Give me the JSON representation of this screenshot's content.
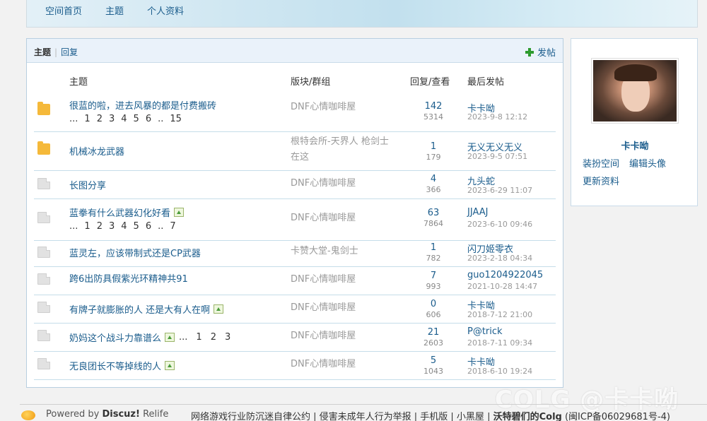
{
  "nav": [
    "空间首页",
    "主题",
    "个人资料"
  ],
  "box_head": {
    "tab_current": "主题",
    "tab_separator": "|",
    "tab_reply": "回复",
    "post_label": "发帖"
  },
  "columns": {
    "title": "主题",
    "forum": "版块/群组",
    "rv": "回复/查看",
    "last": "最后发帖"
  },
  "threads": [
    {
      "icon": "folder",
      "title": "很蓝的啦，进去风暴的都是付费搬砖",
      "pages": [
        "...",
        "1",
        "2",
        "3",
        "4",
        "5",
        "6",
        "..",
        "15"
      ],
      "forum": "DNF心情咖啡屋",
      "replies": "142",
      "views": "5314",
      "last_user": "卡卡呦",
      "last_time": "2023-9-8 12:12"
    },
    {
      "icon": "folder",
      "title": "机械冰龙武器",
      "forum": "根特会所-天界人 枪剑士在这",
      "replies": "1",
      "views": "179",
      "last_user": "无义无义无义",
      "last_time": "2023-9-5 07:51"
    },
    {
      "icon": "doc",
      "title": "长图分享",
      "forum": "DNF心情咖啡屋",
      "replies": "4",
      "views": "366",
      "last_user": "九头蛇",
      "last_time": "2023-6-29 11:07"
    },
    {
      "icon": "doc",
      "title": "蓝拳有什么武器幻化好看",
      "has_image": true,
      "pages": [
        "...",
        "1",
        "2",
        "3",
        "4",
        "5",
        "6",
        "..",
        "7"
      ],
      "forum": "DNF心情咖啡屋",
      "replies": "63",
      "views": "7864",
      "last_user": "JJAAJ",
      "last_time": "2023-6-10 09:46"
    },
    {
      "icon": "doc",
      "title": "蓝灵左，应该带制式还是CP武器",
      "forum": "卡赞大堂-鬼剑士",
      "replies": "1",
      "views": "782",
      "last_user": "闪刀姬零衣",
      "last_time": "2023-2-18 04:34"
    },
    {
      "icon": "doc",
      "title": "跨6出防具假紫光环精神共91",
      "forum": "DNF心情咖啡屋",
      "replies": "7",
      "views": "993",
      "last_user": "guo1204922045",
      "last_time": "2021-10-28 14:47"
    },
    {
      "icon": "doc",
      "title": "有牌子就膨胀的人 还是大有人在啊",
      "has_image": true,
      "forum": "DNF心情咖啡屋",
      "replies": "0",
      "views": "606",
      "last_user": "卡卡呦",
      "last_time": "2018-7-12 21:00"
    },
    {
      "icon": "doc",
      "title": "奶妈这个战斗力靠谱么",
      "has_image": true,
      "inline_pages": [
        "...",
        "1",
        "2",
        "3"
      ],
      "forum": "DNF心情咖啡屋",
      "replies": "21",
      "views": "2603",
      "last_user": "P@trick",
      "last_time": "2018-7-11 09:34"
    },
    {
      "icon": "doc",
      "title": "无良团长不等掉线的人",
      "has_image": true,
      "forum": "DNF心情咖啡屋",
      "replies": "5",
      "views": "1043",
      "last_user": "卡卡呦",
      "last_time": "2018-6-10 19:24"
    }
  ],
  "profile": {
    "username": "卡卡呦",
    "links": [
      "装扮空间",
      "编辑头像",
      "更新资料"
    ]
  },
  "footer": {
    "powered_prefix": "Powered by ",
    "powered_brand": "Discuz!",
    "powered_suffix": " Relife",
    "links_text": "网络游戏行业防沉迷自律公约 | 侵害未成年人行为举报 | 手机版 | 小黑屋 | ",
    "site_name": "沃特碧们的Colg",
    "icp": " (闽ICP备06029681号-4)"
  },
  "watermark": "COLG @卡卡呦"
}
